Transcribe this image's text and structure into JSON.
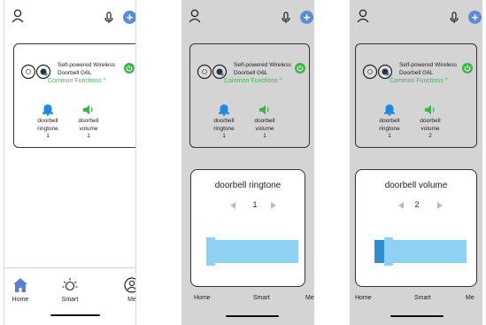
{
  "device": {
    "name": "Self-powered Wireless Doorbell G6L",
    "common_functions_label": "Common Functions ^",
    "ringtone_label": "doorbell ringtone",
    "volume_label": "doorbell volume"
  },
  "screens": [
    {
      "ringtone_value": "1",
      "volume_value": "1"
    },
    {
      "ringtone_value": "1",
      "volume_value": "1",
      "sheet_title": "doorbell ringtone",
      "sheet_value": "1",
      "slider_fraction": 0.0
    },
    {
      "ringtone_value": "1",
      "volume_value": "2",
      "sheet_title": "doorbell volume",
      "sheet_value": "2",
      "slider_fraction": 0.12
    }
  ],
  "tabs": {
    "home": "Home",
    "smart": "Smart",
    "me": "Me"
  },
  "icons": [
    "user-icon",
    "microphone-icon",
    "plus-icon",
    "camera-icon",
    "power-icon",
    "bell-icon",
    "speaker-icon",
    "home-icon",
    "sun-icon",
    "profile-circle-icon",
    "chevron-left-icon",
    "chevron-right-icon"
  ],
  "colors": {
    "accent_green": "#3bb54a",
    "accent_blue": "#5b8dd6",
    "bell_blue": "#1e88e5",
    "slider_light": "#8ed1f2",
    "slider_dark": "#2b8fd3",
    "dim_bg": "#d4d4d4"
  }
}
